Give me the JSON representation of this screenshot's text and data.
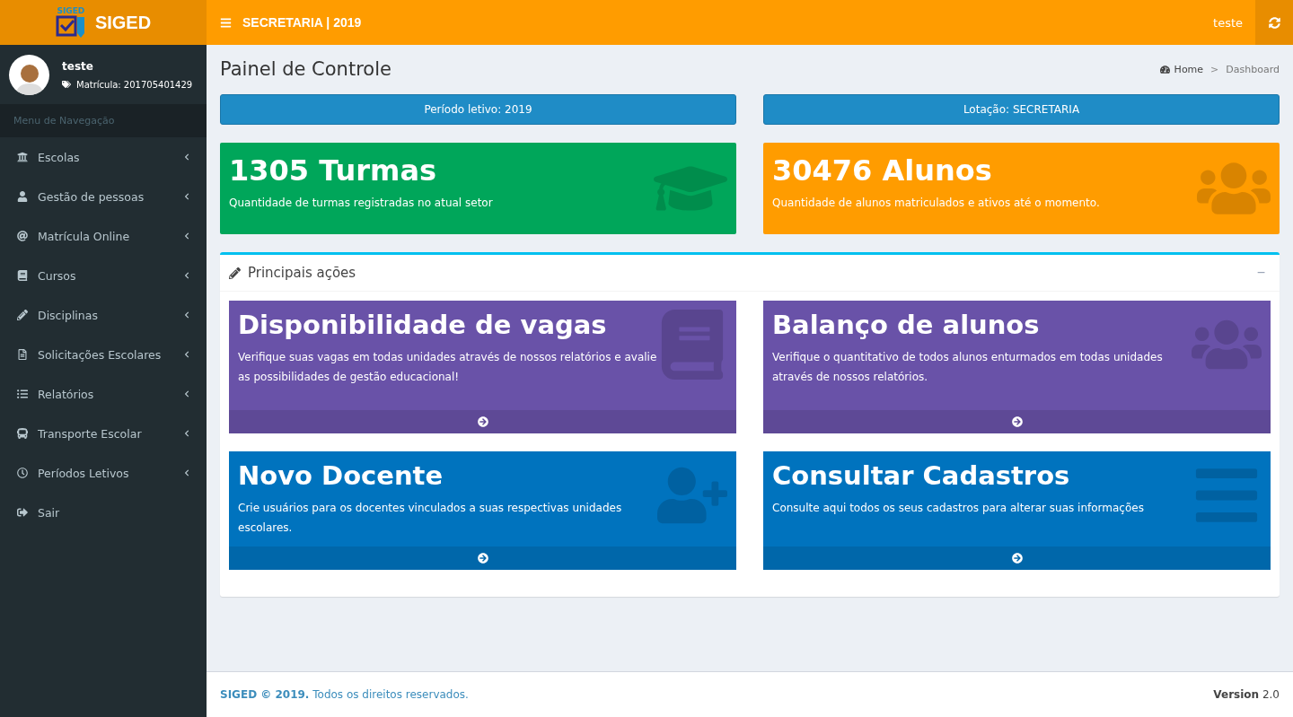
{
  "brand": {
    "logo_text": "SIGED",
    "name": "SIGED"
  },
  "topbar": {
    "title": "SECRETARIA | 2019",
    "user": "teste"
  },
  "user_panel": {
    "name": "teste",
    "registration": "Matrícula: 201705401429"
  },
  "sidebar": {
    "header": "Menu de Navegação",
    "items": [
      {
        "label": "Escolas",
        "expandable": true
      },
      {
        "label": "Gestão de pessoas",
        "expandable": true
      },
      {
        "label": "Matrícula Online",
        "expandable": true
      },
      {
        "label": "Cursos",
        "expandable": true
      },
      {
        "label": "Disciplinas",
        "expandable": true
      },
      {
        "label": "Solicitações Escolares",
        "expandable": true
      },
      {
        "label": "Relatórios",
        "expandable": true
      },
      {
        "label": "Transporte Escolar",
        "expandable": true
      },
      {
        "label": "Períodos Letivos",
        "expandable": true
      },
      {
        "label": "Sair",
        "expandable": false
      }
    ]
  },
  "page": {
    "title": "Painel de Controle",
    "breadcrumb": [
      "Home",
      "Dashboard"
    ],
    "breadcrumb_separator": ">"
  },
  "info_bars": [
    "Período letivo: 2019",
    "Lotação: SECRETARIA"
  ],
  "stat_boxes": [
    {
      "value": "1305 Turmas",
      "description": "Quantidade de turmas registradas no atual setor",
      "color": "#00a65a"
    },
    {
      "value": "30476 Alunos",
      "description": "Quantidade de alunos matriculados e ativos até o momento.",
      "color": "#ff9c00"
    }
  ],
  "actions_panel": {
    "title": "Principais ações",
    "collapse": "−",
    "cards": [
      {
        "title": "Disponibilidade de vagas",
        "description": "Verifique suas vagas em todas unidades através de nossos relatórios e avalie as possibilidades de gestão educacional!",
        "color": "#6952a8"
      },
      {
        "title": "Balanço de alunos",
        "description": "Verifique o quantitativo de todos alunos enturmados em todas unidades através de nossos relatórios.",
        "color": "#6952a8"
      },
      {
        "title": "Novo Docente",
        "description": "Crie usuários para os docentes vinculados a suas respectivas unidades escolares.",
        "color": "#0073be"
      },
      {
        "title": "Consultar Cadastros",
        "description": "Consulte aqui todos os seus cadastros para alterar suas informações",
        "color": "#0073be"
      }
    ]
  },
  "footer": {
    "copyright": "**SIGED © 2019.** Todos os direitos reservados.",
    "version": "**Version** 2.0"
  }
}
